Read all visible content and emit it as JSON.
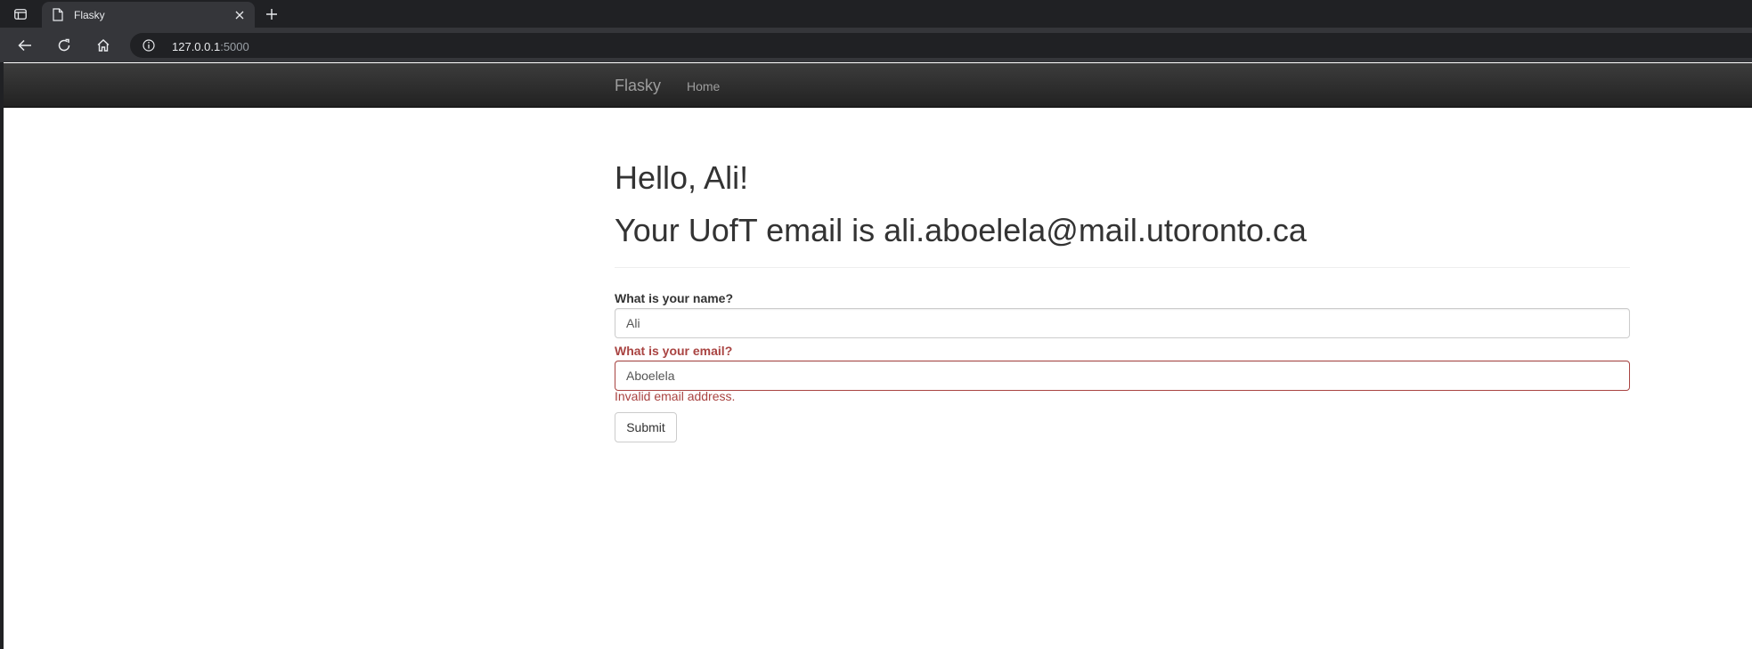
{
  "browser": {
    "tab_title": "Flasky",
    "url_host": "127.0.0.1",
    "url_port": ":5000"
  },
  "navbar": {
    "brand": "Flasky",
    "home_link": "Home"
  },
  "main": {
    "greeting": "Hello, Ali!",
    "email_line": "Your UofT email is ali.aboelela@mail.utoronto.ca"
  },
  "form": {
    "name_label": "What is your name?",
    "name_value": "Ali",
    "email_label": "What is your email?",
    "email_value": "Aboelela",
    "email_error": "Invalid email address.",
    "submit_label": "Submit"
  },
  "colors": {
    "error": "#a94442",
    "navbar_bg": "#222222",
    "chrome_bg": "#202124"
  }
}
